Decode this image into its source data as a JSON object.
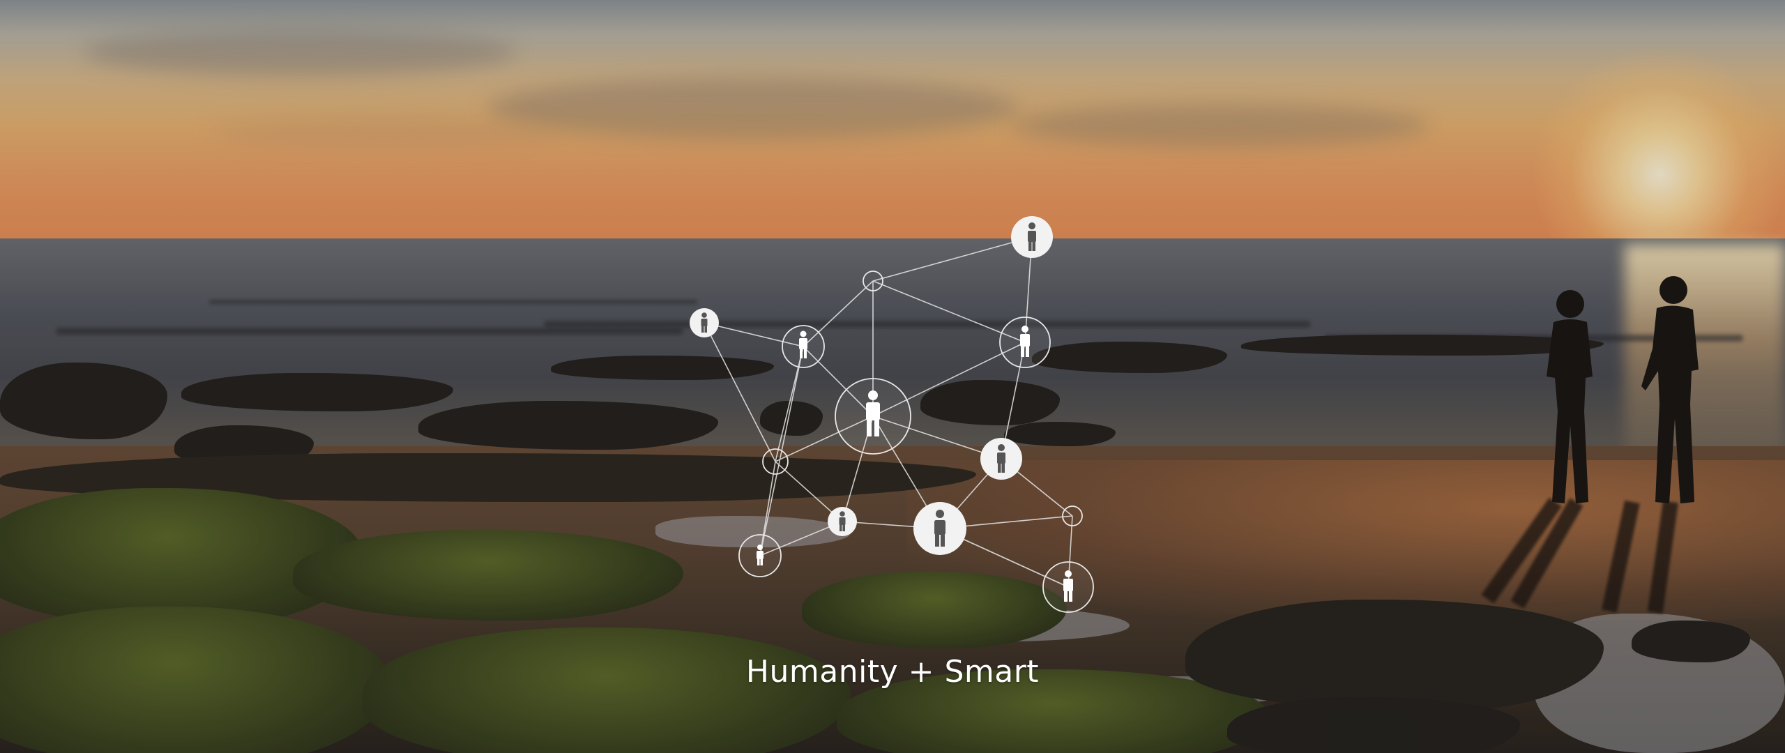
{
  "tagline": "Humanity + Smart",
  "network": {
    "line_color": "#e8e8e8",
    "node_fill": "#ffffff",
    "person_icon_color": "#555555"
  },
  "scene": {
    "sky_colors": [
      "#8e959a",
      "#d8b98d",
      "#e7b272",
      "#e99058"
    ],
    "sea_color": "#55575f",
    "sand_color": "#6a4e3a",
    "moss_color": "#5d6a2c"
  }
}
